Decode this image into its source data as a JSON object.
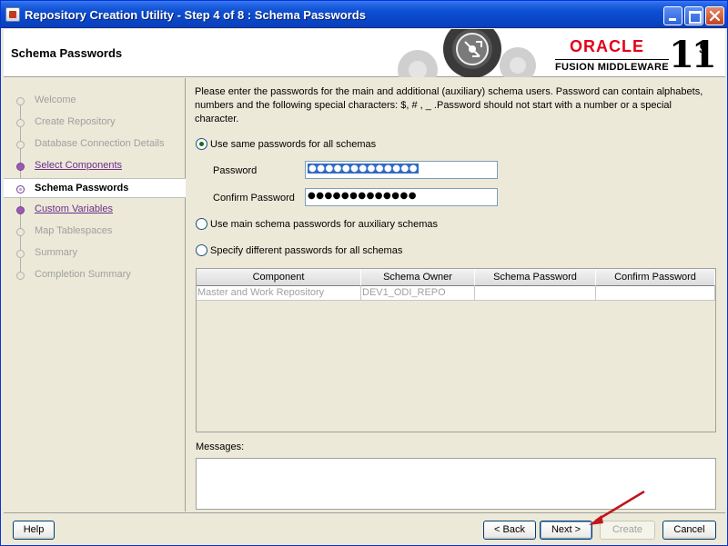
{
  "window": {
    "title": "Repository Creation Utility - Step 4 of 8 : Schema Passwords"
  },
  "header": {
    "page_title": "Schema Passwords",
    "brand": "ORACLE",
    "product": "FUSION MIDDLEWARE",
    "version": "11",
    "version_suffix": "g"
  },
  "nav": {
    "items": [
      {
        "label": "Welcome",
        "state": "pending"
      },
      {
        "label": "Create Repository",
        "state": "pending"
      },
      {
        "label": "Database Connection Details",
        "state": "pending"
      },
      {
        "label": "Select Components",
        "state": "done"
      },
      {
        "label": "Schema Passwords",
        "state": "active"
      },
      {
        "label": "Custom Variables",
        "state": "done"
      },
      {
        "label": "Map Tablespaces",
        "state": "pending"
      },
      {
        "label": "Summary",
        "state": "pending"
      },
      {
        "label": "Completion Summary",
        "state": "pending"
      }
    ]
  },
  "main": {
    "intro": "Please enter the passwords for the main and additional (auxiliary) schema users. Password can contain alphabets, numbers and the following special characters: $, # , _ .Password should not start with a number or a special character.",
    "options": {
      "same": {
        "label": "Use same passwords for all schemas",
        "checked": true
      },
      "main_aux": {
        "label": "Use main schema passwords for auxiliary schemas",
        "checked": false
      },
      "different": {
        "label": "Specify different passwords for all schemas",
        "checked": false
      }
    },
    "password_label": "Password",
    "password_value": "●●●●●●●●●●●●●",
    "confirm_label": "Confirm Password",
    "confirm_value": "●●●●●●●●●●●●●",
    "table": {
      "columns": [
        "Component",
        "Schema Owner",
        "Schema Password",
        "Confirm Password"
      ],
      "rows": [
        [
          "Master and Work Repository",
          "DEV1_ODI_REPO",
          "",
          ""
        ]
      ]
    },
    "messages_label": "Messages:",
    "messages_text": ""
  },
  "buttons": {
    "help": "Help",
    "back": "< Back",
    "next": "Next >",
    "create": "Create",
    "cancel": "Cancel"
  },
  "colors": {
    "titlebar": "#0a46c8",
    "oracle_red": "#e3001b",
    "nav_done": "#6b2f8a",
    "annotation_arrow": "#c0161c"
  }
}
